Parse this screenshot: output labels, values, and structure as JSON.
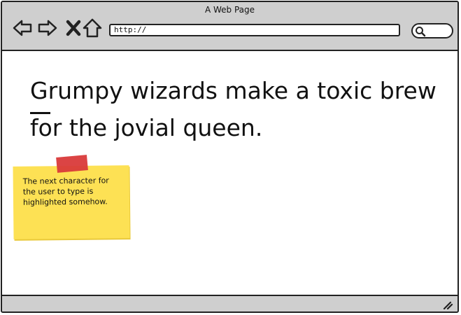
{
  "window": {
    "title": "A Web Page"
  },
  "toolbar": {
    "back_icon": "back-arrow-icon",
    "forward_icon": "forward-arrow-icon",
    "stop_icon": "close-icon",
    "home_icon": "home-icon",
    "search_icon": "search-icon"
  },
  "address_bar": {
    "value": "http://"
  },
  "content": {
    "headline_first_char": "G",
    "headline_rest": "rumpy wizards make a toxic brew for the jovial queen."
  },
  "sticky_note": {
    "text": "The next character for the user to type is highlighted somehow.",
    "color": "#fde154",
    "tape_color": "#d93a3a"
  },
  "status_bar": {
    "resize_icon": "resize-grip-icon"
  }
}
